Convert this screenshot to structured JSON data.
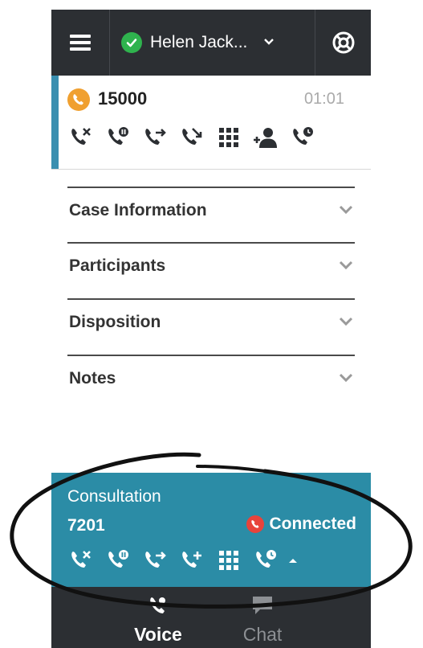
{
  "header": {
    "user_name": "Helen Jack...",
    "status_color": "#2fb34e"
  },
  "call": {
    "number": "15000",
    "timer": "01:01",
    "actions": [
      "end-call-icon",
      "hold-call-icon",
      "transfer-call-icon",
      "consult-call-icon",
      "dialpad-icon",
      "conference-icon",
      "schedule-callback-icon"
    ]
  },
  "sections": [
    {
      "label": "Case Information"
    },
    {
      "label": "Participants"
    },
    {
      "label": "Disposition"
    },
    {
      "label": "Notes"
    }
  ],
  "consultation": {
    "title": "Consultation",
    "number": "7201",
    "status": "Connected",
    "status_color": "#e8433b",
    "actions": [
      "end-call-icon",
      "hold-call-icon",
      "transfer-call-icon",
      "add-call-icon",
      "dialpad-icon",
      "schedule-callback-icon",
      "caret-up-icon"
    ]
  },
  "tabs": [
    {
      "label": "Voice",
      "active": true
    },
    {
      "label": "Chat",
      "active": false
    }
  ]
}
